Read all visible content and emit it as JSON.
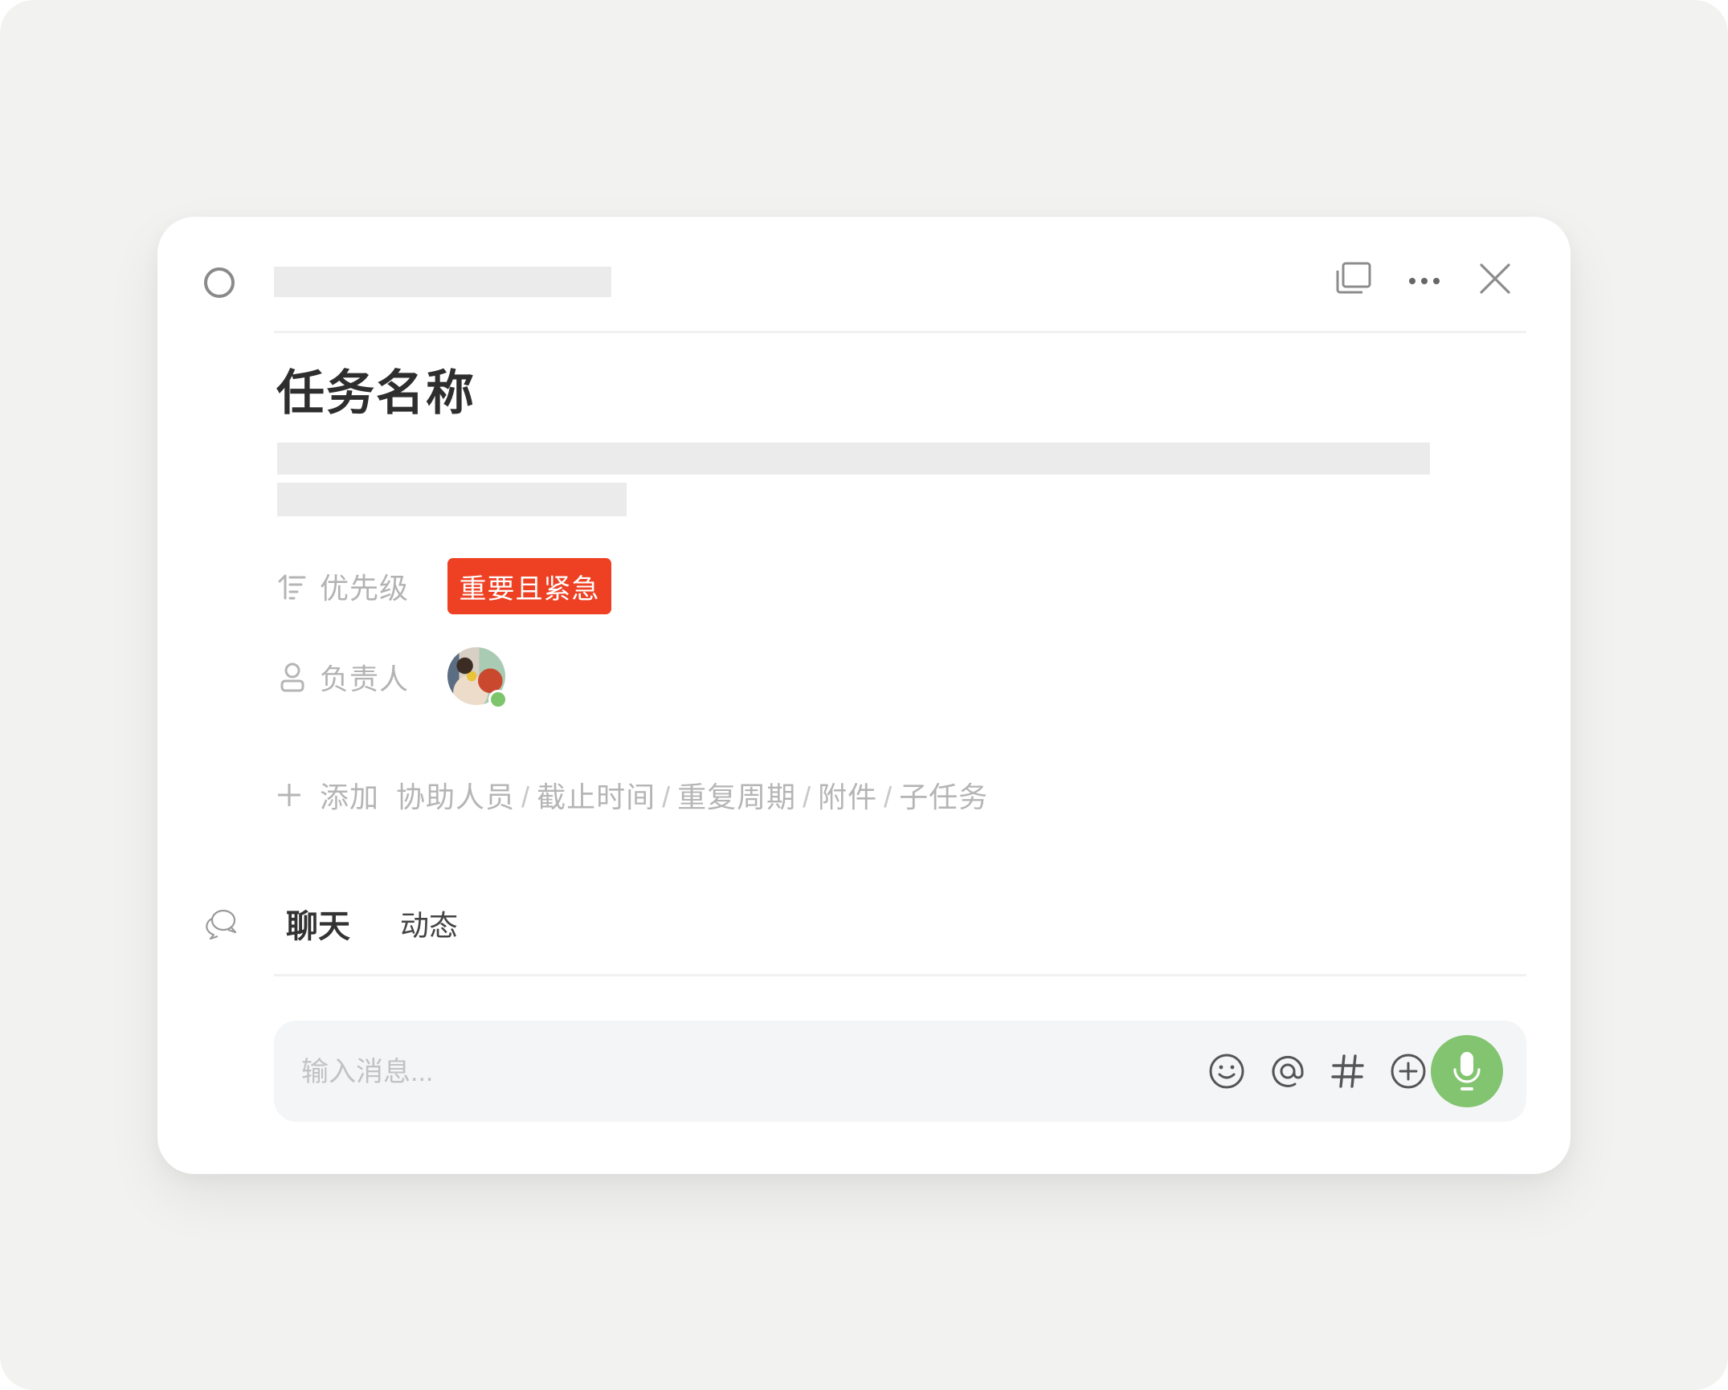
{
  "task": {
    "title": "任务名称",
    "completed": false
  },
  "header": {
    "icons": [
      "copy-window-icon",
      "more-icon",
      "close-icon"
    ]
  },
  "fields": {
    "priority": {
      "label": "优先级",
      "icon": "priority-sort-icon",
      "value": "重要且紧急",
      "color": "#EE4023"
    },
    "assignee": {
      "label": "负责人",
      "icon": "user-icon",
      "online": true,
      "status_color": "#7DC56B"
    }
  },
  "add_row": {
    "plus_icon": "plus-icon",
    "prefix": "添加",
    "options": [
      "协助人员",
      "截止时间",
      "重复周期",
      "附件",
      "子任务"
    ],
    "separator": "/"
  },
  "tabs": {
    "icon": "chat-bubbles-icon",
    "items": [
      {
        "label": "聊天",
        "active": true
      },
      {
        "label": "动态",
        "active": false
      }
    ]
  },
  "composer": {
    "placeholder": "输入消息...",
    "value": "",
    "icons": [
      "emoji-icon",
      "mention-icon",
      "hashtag-icon",
      "add-circle-icon",
      "microphone-icon"
    ],
    "mic_color": "#82C46F"
  }
}
